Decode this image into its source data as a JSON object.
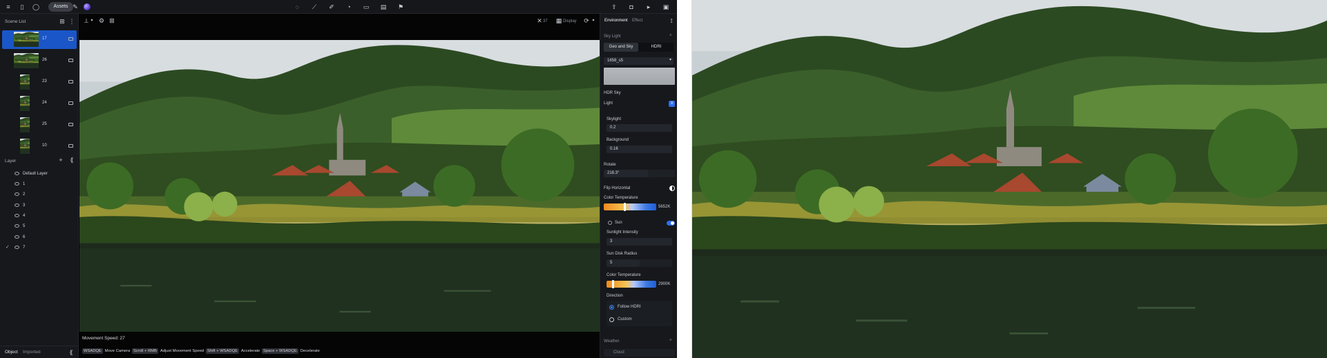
{
  "topbar": {
    "assets_label": "Assets"
  },
  "scene_list": {
    "title": "Scene List",
    "items": [
      {
        "label": "17",
        "selected": true
      },
      {
        "label": "26",
        "selected": false
      },
      {
        "label": "23",
        "selected": false
      },
      {
        "label": "24",
        "selected": false
      },
      {
        "label": "25",
        "selected": false
      },
      {
        "label": "10",
        "selected": false
      }
    ]
  },
  "layers": {
    "title": "Layer",
    "items": [
      "Default Layer",
      "1",
      "2",
      "3",
      "4",
      "5",
      "6",
      "7"
    ]
  },
  "left_tabs": {
    "object": "Object",
    "imported": "Imported"
  },
  "viewport": {
    "speed_text": "Movement Speed: 27",
    "shortcuts": [
      {
        "key": "WSADQE",
        "action": "Move Camera"
      },
      {
        "key": "Scroll + RMB",
        "action": "Adjust Movement Speed"
      },
      {
        "key": "Shift + WSADQE",
        "action": "Accelerate"
      },
      {
        "key": "Space + WSADQE",
        "action": "Decelerate"
      }
    ],
    "toolbar_right": {
      "item1": "37",
      "item2": "Display"
    }
  },
  "right_panel": {
    "tabs": {
      "environment": "Environment",
      "effect": "Effect"
    },
    "sky_light": "Sky Light",
    "mode_geo": "Geo and Sky",
    "mode_hdri": "HDRI",
    "hdri_select": "1658_s5",
    "hdr_sky": "HDR Sky",
    "light": "Light",
    "skylight_label": "Skylight",
    "skylight_value": "0.2",
    "background_label": "Background",
    "background_value": "0.16",
    "rotate_label": "Rotate",
    "rotate_value": "218.3°",
    "flip_label": "Flip Horizontal",
    "color_temp_label": "Color Temperature",
    "color_temp_value": "5652K",
    "color_temp_fraction": 0.4,
    "sun_label": "Sun",
    "sun_intensity_label": "Sunlight Intensity",
    "sun_intensity_value": "3",
    "sun_disk_label": "Sun Disk Radius",
    "sun_disk_value": "5",
    "sun_temp_label": "Color Temperature",
    "sun_temp_value": "2900K",
    "sun_temp_fraction": 0.12,
    "direction_label": "Direction",
    "follow_hdri": "Follow HDRI",
    "custom": "Custom",
    "weather_label": "Weather",
    "cloud_label": "Cloud"
  },
  "colors": {
    "accent": "#1b56c8",
    "toggle": "#2f6df0"
  }
}
